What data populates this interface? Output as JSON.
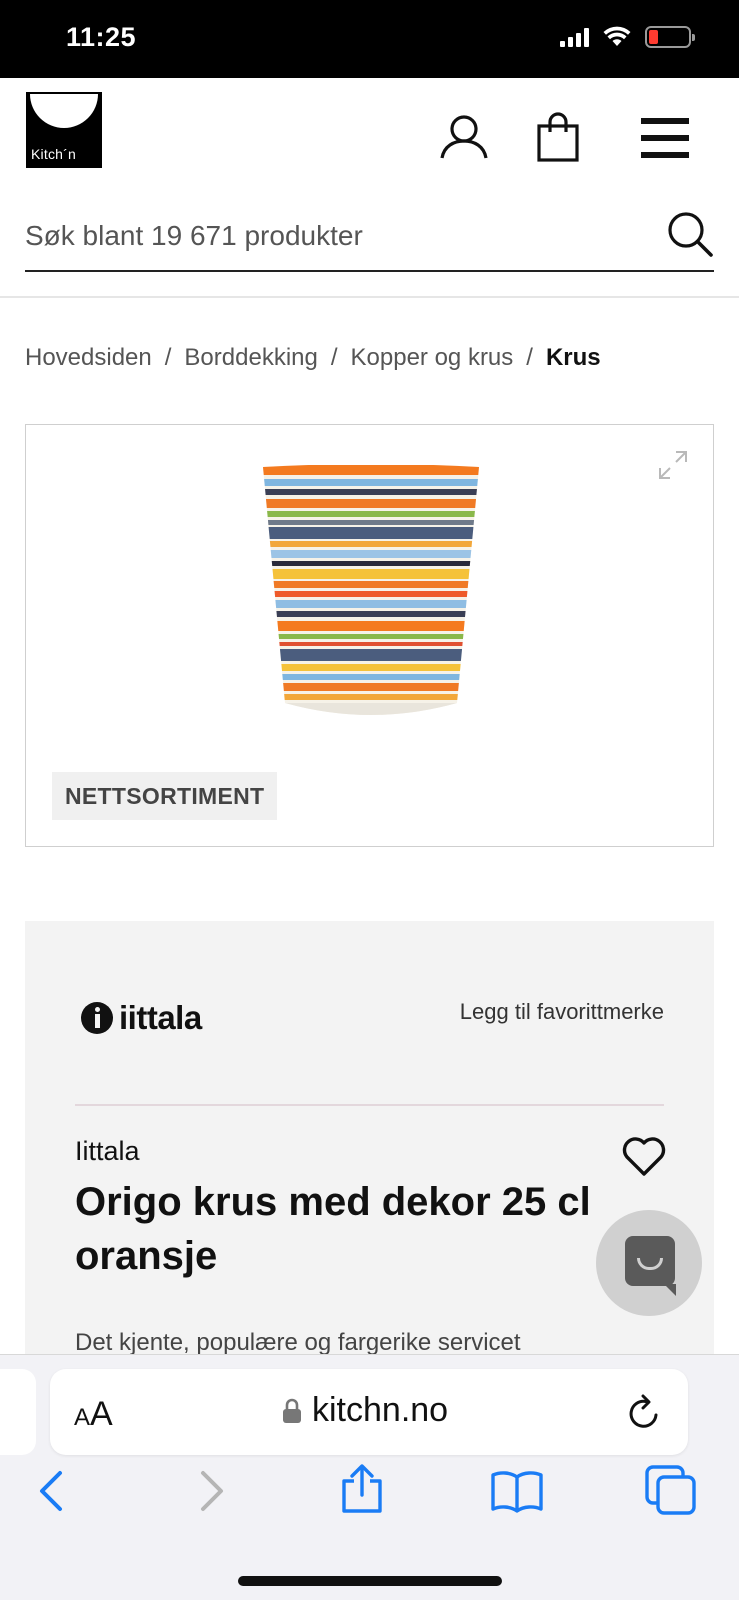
{
  "status_bar": {
    "time": "11:25"
  },
  "header": {
    "logo_text": "Kitch´n"
  },
  "search": {
    "placeholder": "Søk blant 19 671 produkter"
  },
  "breadcrumb": {
    "items": [
      "Hovedsiden",
      "Borddekking",
      "Kopper og krus"
    ],
    "current": "Krus",
    "separator": "/"
  },
  "product_image": {
    "badge": "NETTSORTIMENT"
  },
  "product": {
    "brand_logo": "iittala",
    "favorite_brand_label": "Legg til favorittmerke",
    "brand": "Iittala",
    "title": "Origo krus med dekor 25 cl oransje",
    "description": "Det kjente, populære og fargerike servicet"
  },
  "browser": {
    "text_size_label_small": "A",
    "text_size_label_large": "A",
    "url": "kitchn.no"
  },
  "colors": {
    "accent_blue": "#1a7cf5",
    "battery_low": "#ff3b30"
  }
}
